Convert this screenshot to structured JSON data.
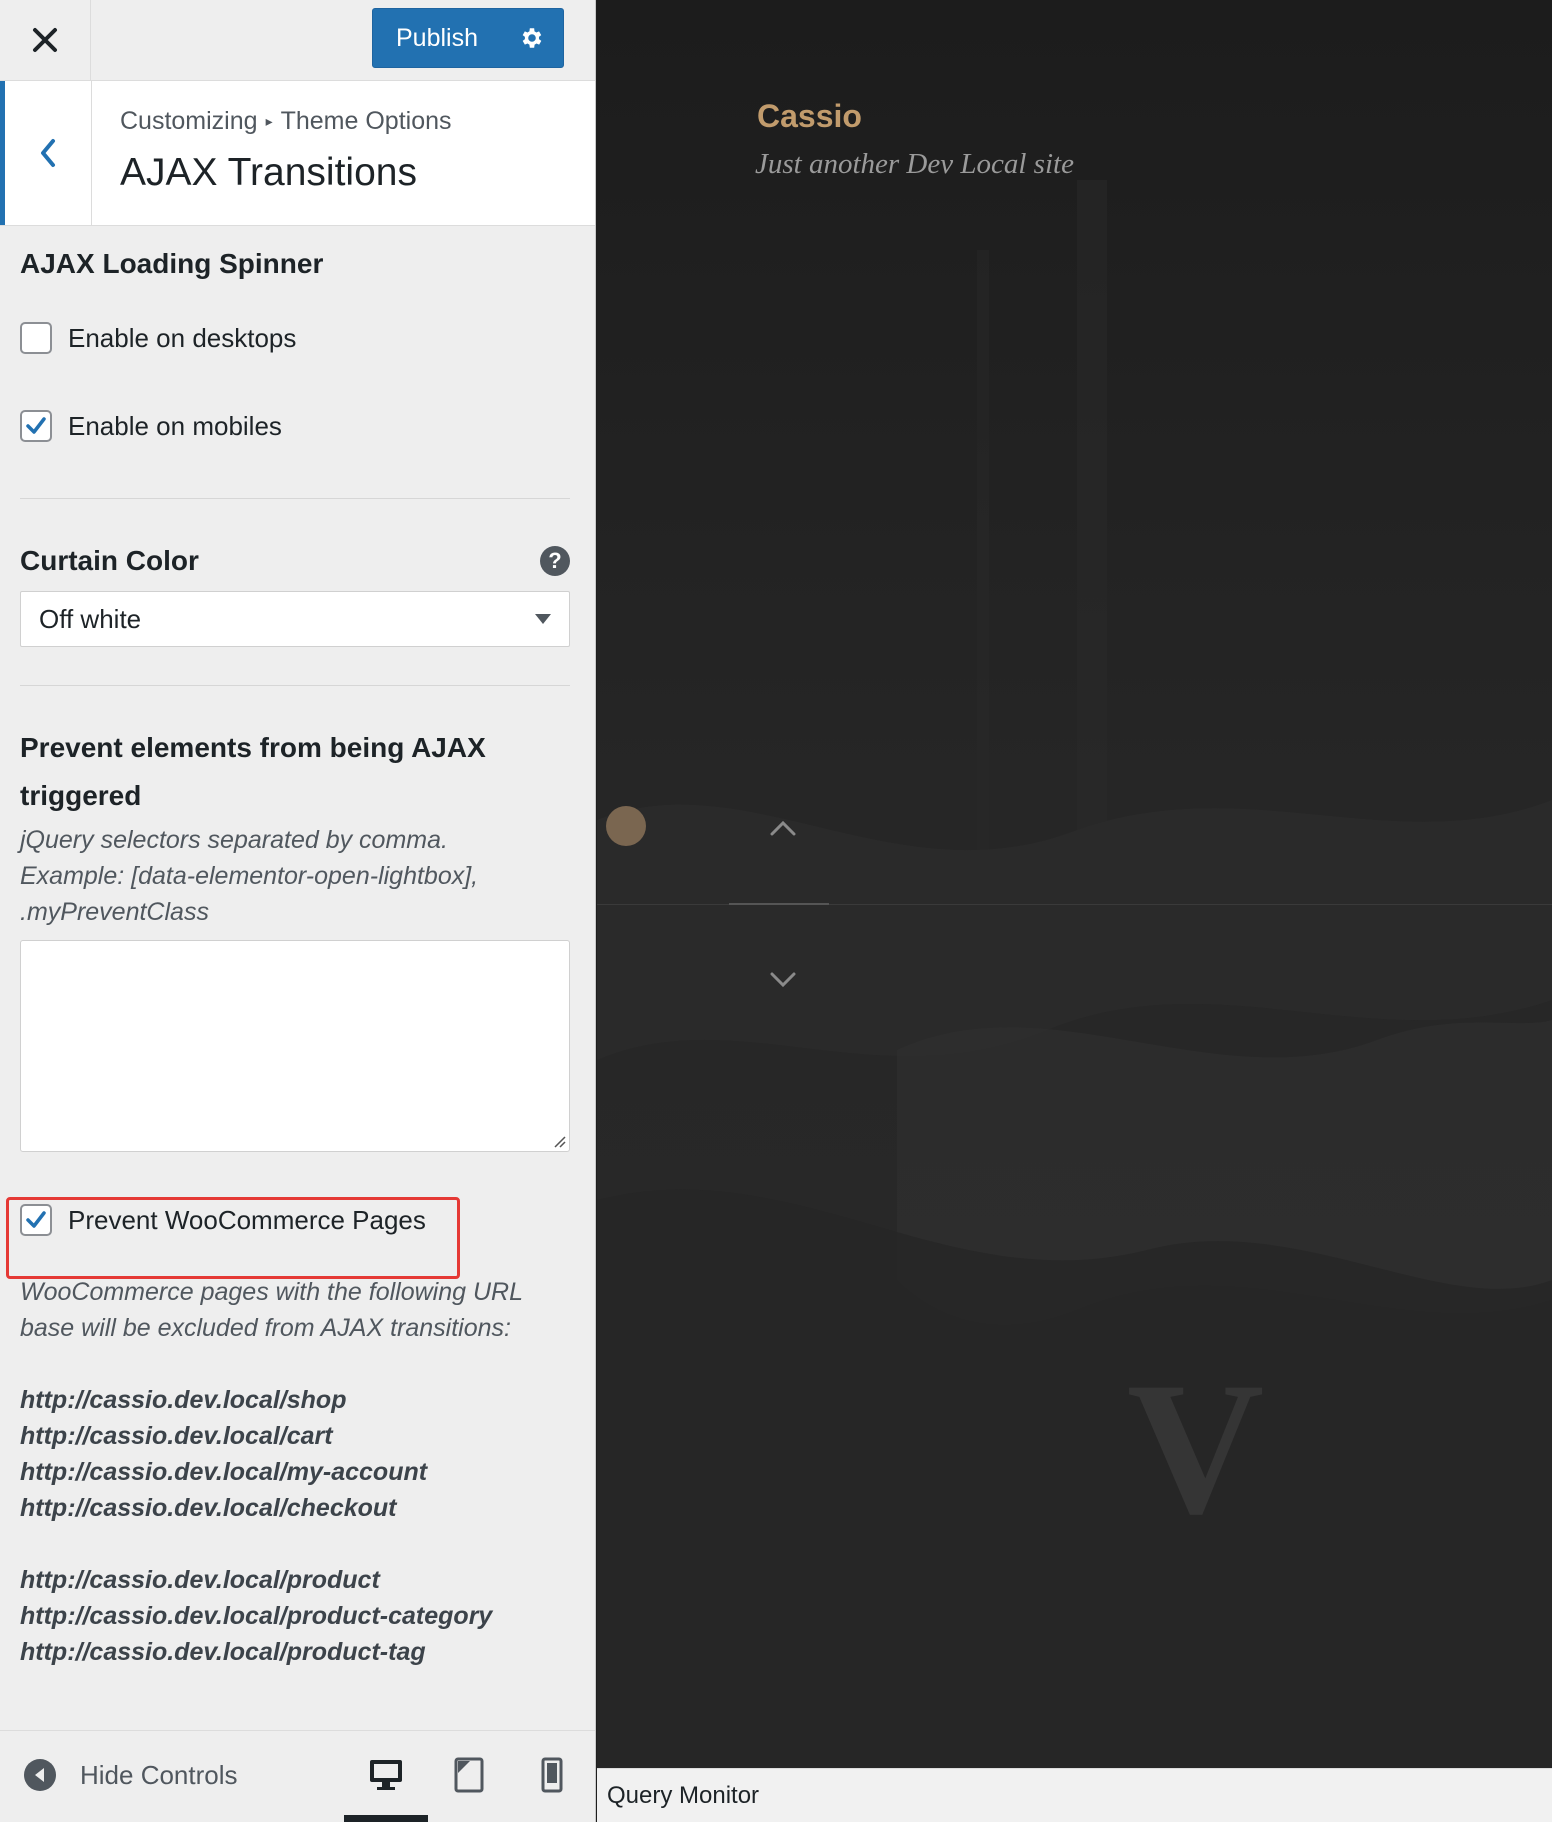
{
  "header": {
    "publish_label": "Publish"
  },
  "section": {
    "breadcrumb_root": "Customizing",
    "breadcrumb_parent": "Theme Options",
    "title": "AJAX Transitions"
  },
  "spinner": {
    "title": "AJAX Loading Spinner",
    "desktop_label": "Enable on desktops",
    "desktop_checked": false,
    "mobile_label": "Enable on mobiles",
    "mobile_checked": true
  },
  "curtain": {
    "title": "Curtain Color",
    "selected": "Off white"
  },
  "prevent": {
    "title_line1": "Prevent elements from being AJAX",
    "title_line2": "triggered",
    "desc_line1": "jQuery selectors separated by comma.",
    "desc_line2": "Example: [data-elementor-open-lightbox],",
    "desc_line3": ".myPreventClass",
    "textarea_value": ""
  },
  "woo": {
    "label": "Prevent WooCommerce Pages",
    "checked": true,
    "desc_line1": "WooCommerce pages with the following URL",
    "desc_line2": "base will be excluded from AJAX transitions:",
    "urls_group1": [
      "http://cassio.dev.local/shop",
      "http://cassio.dev.local/cart",
      "http://cassio.dev.local/my-account",
      "http://cassio.dev.local/checkout"
    ],
    "urls_group2": [
      "http://cassio.dev.local/product",
      "http://cassio.dev.local/product-category",
      "http://cassio.dev.local/product-tag"
    ]
  },
  "footer": {
    "hide_controls_label": "Hide Controls",
    "active_device": "desktop"
  },
  "preview": {
    "site_title": "Cassio",
    "site_tagline": "Just another Dev Local site",
    "watermark_letter": "V"
  },
  "query_monitor": {
    "label": "Query Monitor"
  },
  "colors": {
    "accent": "#2271b1",
    "highlight_box": "#e53935",
    "site_title": "#c19b6c"
  },
  "icons": [
    "close-icon",
    "gear-icon",
    "chevron-left-icon",
    "help-icon",
    "dropdown-arrow-icon",
    "check-icon",
    "arrow-left-circle-icon",
    "desktop-icon",
    "tablet-icon",
    "mobile-icon",
    "chevron-up-icon",
    "chevron-down-icon"
  ]
}
